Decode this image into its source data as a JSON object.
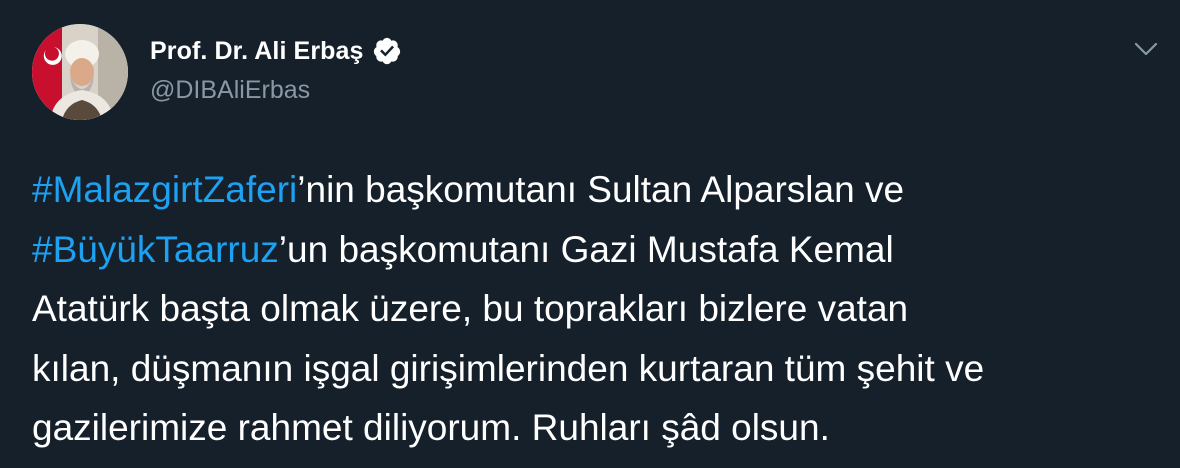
{
  "user": {
    "display_name": "Prof. Dr. Ali Erbaş",
    "handle": "@DIBAliErbas",
    "verified_icon": "verified-badge-icon",
    "avatar_icon": "profile-photo"
  },
  "menu": {
    "icon": "chevron-down-icon"
  },
  "tweet": {
    "hashtag1": "#MalazgirtZaferi",
    "text1": "’nin başkomutanı Sultan Alparslan ve",
    "hashtag2": "#BüyükTaarruz",
    "text2": "’un başkomutanı Gazi Mustafa Kemal",
    "text3": "Atatürk başta olmak üzere, bu toprakları bizlere vatan",
    "text4": "kılan, düşmanın işgal girişimlerinden kurtaran tüm şehit ve",
    "text5": "gazilerimize rahmet diliyorum. Ruhları şâd olsun."
  },
  "colors": {
    "background": "#15202b",
    "text": "#ffffff",
    "secondary": "#8899a6",
    "link": "#1da1f2"
  }
}
